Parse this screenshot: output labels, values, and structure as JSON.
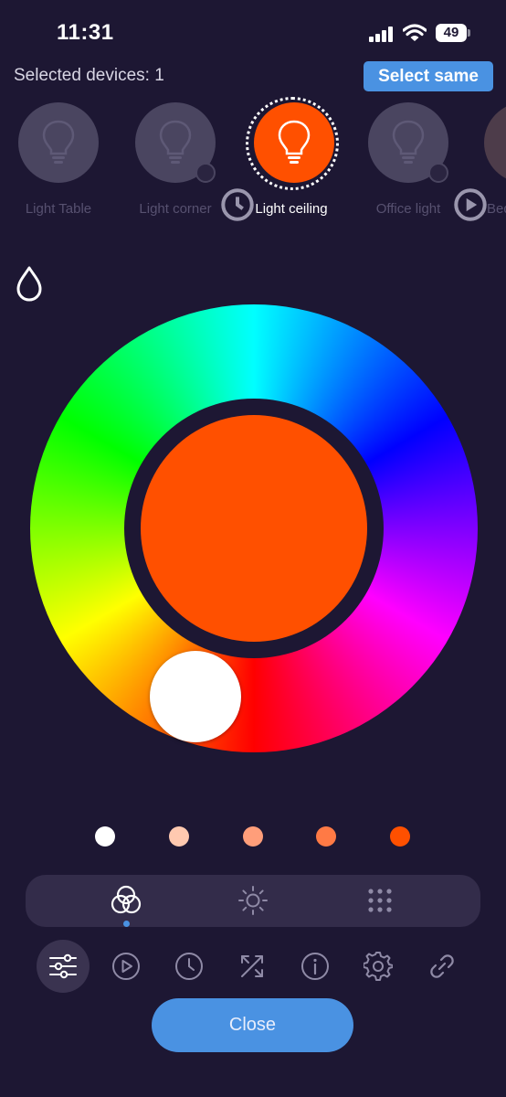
{
  "status_bar": {
    "time": "11:31",
    "battery": "49"
  },
  "header": {
    "selected_devices": "Selected devices: 1",
    "select_same_label": "Select same"
  },
  "devices": [
    {
      "label": "Light Table",
      "state": "off",
      "icon": "bulb-icon"
    },
    {
      "label": "Light corner",
      "state": "off",
      "icon": "bulb-icon",
      "badge": "clock-icon"
    },
    {
      "label": "Light ceiling",
      "state": "selected",
      "icon": "bulb-icon"
    },
    {
      "label": "Office light",
      "state": "off",
      "icon": "bulb-icon",
      "badge": "play-icon"
    },
    {
      "label": "Bed",
      "state": "off",
      "icon": "bulb-icon"
    }
  ],
  "color_picker": {
    "current_color": "#ff5000",
    "knob_color": "#ffffff"
  },
  "presets": [
    "#ffffff",
    "#ffc9b0",
    "#ff9e7a",
    "#ff7a45",
    "#ff5000"
  ],
  "mode_tabs": [
    {
      "icon": "color-circles-icon",
      "active": true
    },
    {
      "icon": "sun-icon",
      "active": false
    },
    {
      "icon": "dots-grid-icon",
      "active": false
    }
  ],
  "toolbar": [
    {
      "icon": "sliders-icon",
      "active": true
    },
    {
      "icon": "play-icon",
      "active": false
    },
    {
      "icon": "clock-icon",
      "active": false
    },
    {
      "icon": "shuffle-icon",
      "active": false
    },
    {
      "icon": "info-icon",
      "active": false
    },
    {
      "icon": "gear-icon",
      "active": false
    },
    {
      "icon": "link-icon",
      "active": false
    }
  ],
  "close_label": "Close",
  "colors": {
    "background": "#1d1733",
    "accent": "#4a92e2",
    "selected_light": "#ff5000",
    "inactive_device": "#4a4560"
  }
}
